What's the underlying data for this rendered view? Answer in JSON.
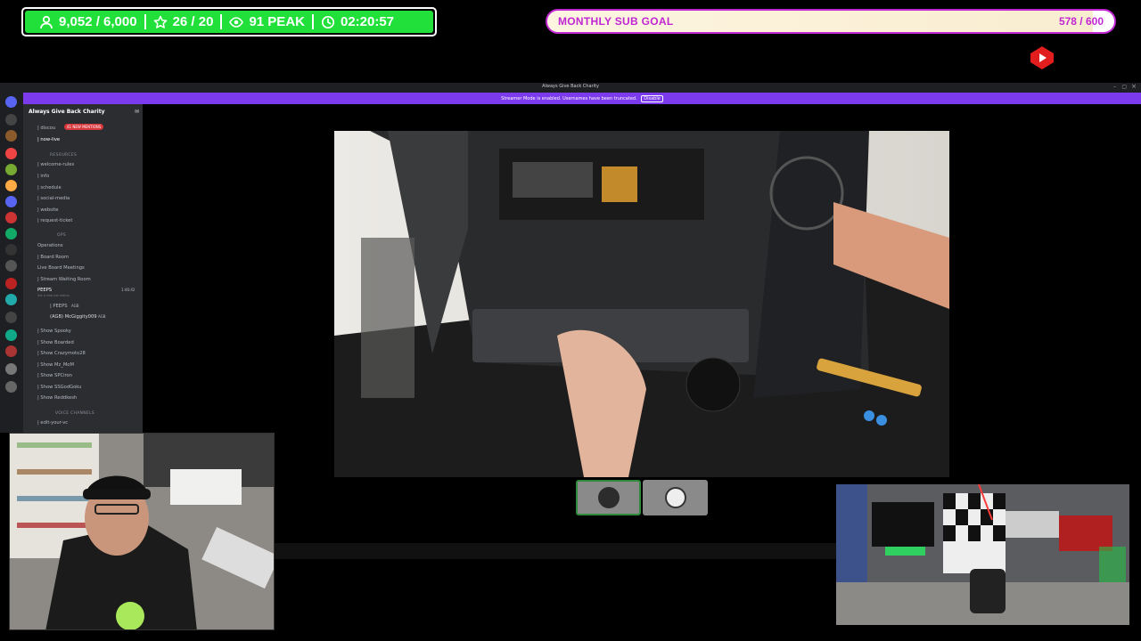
{
  "stats": {
    "followers": "9,052 / 6,000",
    "stars": "26 / 20",
    "viewers": "91 PEAK",
    "timer": "02:20:57"
  },
  "sub_goal": {
    "label": "MONTHLY SUB GOAL",
    "count": "578 / 600",
    "progress_fraction": 0.963
  },
  "discord": {
    "window_title": "Always Give Back Charity",
    "banner_text": "Streamer Mode is enabled. Usernames have been truncated.",
    "banner_button": "Disable",
    "server_name": "Always Give Back Charity",
    "mentions_badge": "41 NEW MENTIONS",
    "channels_top": [
      "| discou",
      "| now-live"
    ],
    "category_resources": "RESOURCES",
    "resources": [
      "| welcome-rules",
      "| info",
      "| schedule",
      "| social-media",
      "| website",
      "| request-ticket"
    ],
    "category_ops": "OPS",
    "ops": [
      "Operations",
      "| Board Room",
      "Live Board Meetings",
      "| Stream Waiting Room",
      "PEEPS"
    ],
    "peeps_status": "Set a channel status",
    "peeps_time": "1:46:42",
    "voice_users": [
      "| PEEPS",
      "(AGB) McGiggity009"
    ],
    "user_tag": "AGB",
    "shows": [
      "| Show Spooky",
      "| Show Boarded",
      "| Show Crazymoto28",
      "| Show Mz_MoM",
      "| Show SPCiron",
      "| Show SSGodGoku",
      "| Show Reddkesh"
    ],
    "category_voice": "VOICE CHANNELS",
    "voice_first": "| edit-your-vc"
  },
  "colors": {
    "stats_green": "#22e03a",
    "goal_magenta": "#c026d3",
    "discord_banner": "#7c3aed",
    "youtube_red": "#e11d1d"
  }
}
